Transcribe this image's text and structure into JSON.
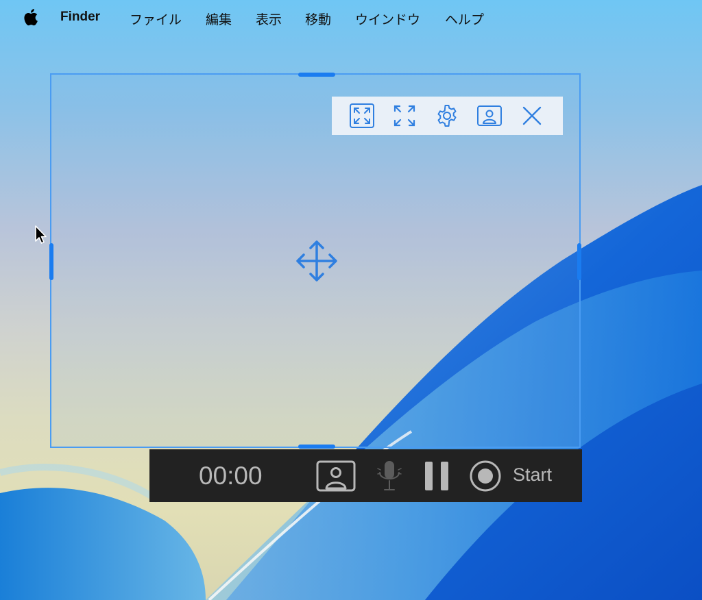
{
  "menubar": {
    "app_name": "Finder",
    "items": [
      "ファイル",
      "編集",
      "表示",
      "移動",
      "ウインドウ",
      "ヘルプ"
    ]
  },
  "selection_toolbar": {
    "icons": [
      "fit-screen-icon",
      "fullscreen-icon",
      "gear-icon",
      "webcam-icon",
      "close-icon"
    ]
  },
  "recording_bar": {
    "timer": "00:00",
    "start_label": "Start",
    "icons": [
      "webcam-icon",
      "microphone-icon",
      "pause-icon",
      "record-icon"
    ]
  },
  "colors": {
    "accent": "#1a7cf0",
    "frame": "#4a9cf2",
    "toolbar_bg": "#e9f0f8",
    "recbar_bg": "#222222",
    "recbar_fg": "#b8b8b8"
  }
}
